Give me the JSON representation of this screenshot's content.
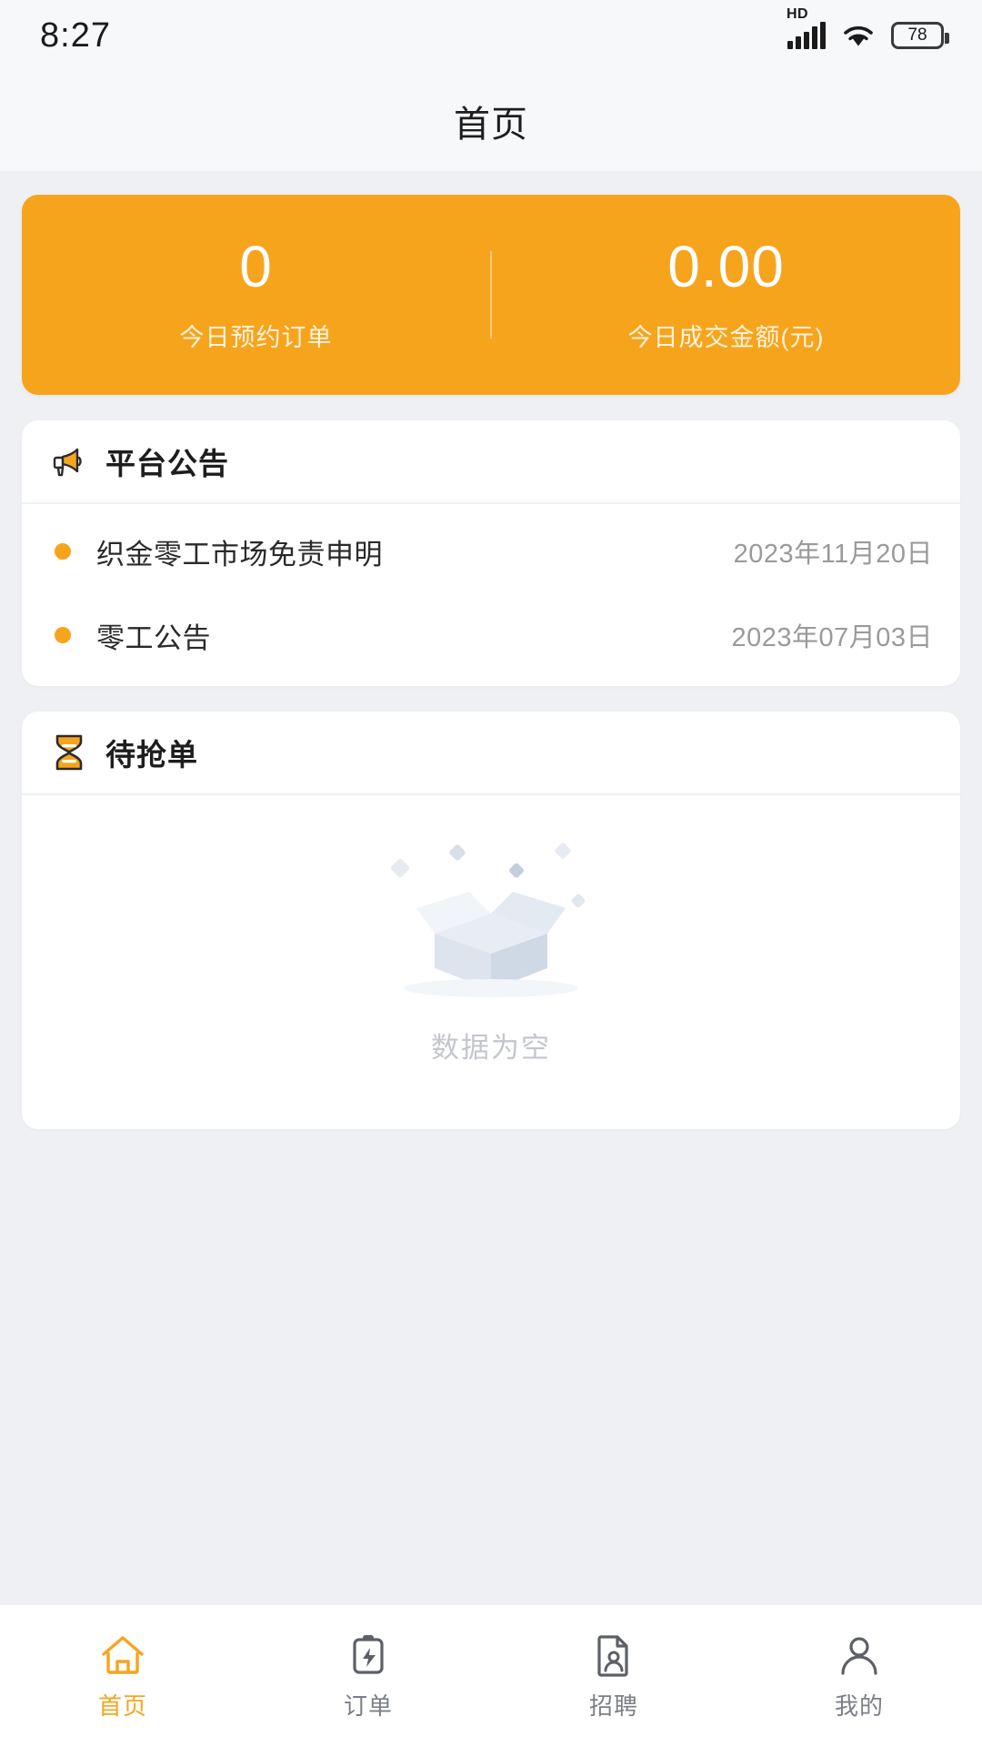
{
  "status_bar": {
    "time": "8:27",
    "network_label": "HD",
    "battery_level": "78",
    "icons": [
      "hd-signal-icon",
      "wifi-icon",
      "battery-icon"
    ]
  },
  "navbar": {
    "title": "首页"
  },
  "stats": {
    "orders": {
      "value": "0",
      "label": "今日预约订单"
    },
    "amount": {
      "value": "0.00",
      "label": "今日成交金额(元)"
    }
  },
  "announcements": {
    "header": {
      "title": "平台公告",
      "icon": "megaphone-icon"
    },
    "items": [
      {
        "title": "织金零工市场免责申明",
        "date": "2023年11月20日"
      },
      {
        "title": "零工公告",
        "date": "2023年07月03日"
      }
    ]
  },
  "pending_orders": {
    "header": {
      "title": "待抢单",
      "icon": "hourglass-icon"
    },
    "empty_text": "数据为空",
    "empty_illustration": "empty-box-illustration"
  },
  "tabbar": {
    "items": [
      {
        "label": "首页",
        "icon": "home-icon",
        "active": true
      },
      {
        "label": "订单",
        "icon": "order-icon",
        "active": false
      },
      {
        "label": "招聘",
        "icon": "recruit-icon",
        "active": false
      },
      {
        "label": "我的",
        "icon": "profile-icon",
        "active": false
      }
    ]
  },
  "colors": {
    "accent": "#f7a41d",
    "page_bg": "#eef0f4",
    "card_bg": "#ffffff",
    "muted_text": "#9a9a9a"
  }
}
